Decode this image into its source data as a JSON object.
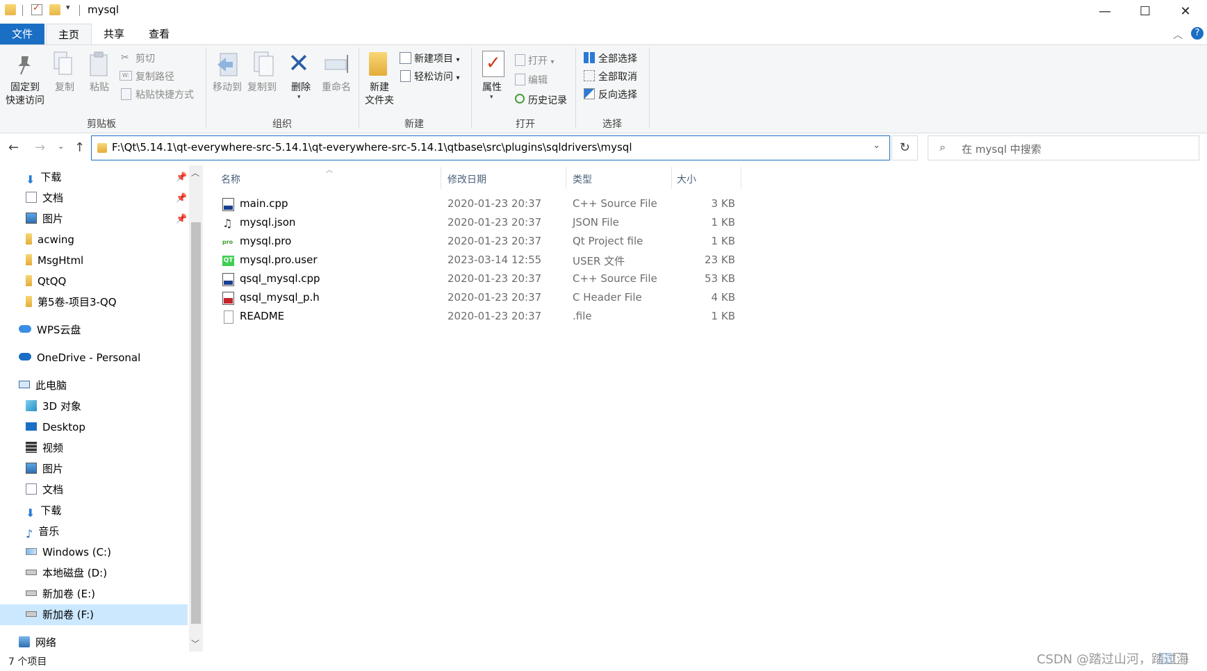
{
  "window": {
    "title": "mysql",
    "minimize_glyph": "—",
    "maximize_glyph": "☐",
    "close_glyph": "✕"
  },
  "tabs": [
    {
      "label": "文件"
    },
    {
      "label": "主页"
    },
    {
      "label": "共享"
    },
    {
      "label": "查看"
    }
  ],
  "ribbon": {
    "clipboard": {
      "group_label": "剪贴板",
      "pin_label_1": "固定到",
      "pin_label_2": "快速访问",
      "copy": "复制",
      "paste": "粘贴",
      "cut": "剪切",
      "copy_path": "复制路径",
      "paste_shortcut": "粘贴快捷方式"
    },
    "organize": {
      "group_label": "组织",
      "move_to": "移动到",
      "copy_to": "复制到",
      "delete": "删除",
      "rename": "重命名"
    },
    "new": {
      "group_label": "新建",
      "new_folder_1": "新建",
      "new_folder_2": "文件夹",
      "new_item": "新建项目",
      "easy_access": "轻松访问"
    },
    "open": {
      "group_label": "打开",
      "properties": "属性",
      "open": "打开",
      "edit": "编辑",
      "history": "历史记录"
    },
    "select": {
      "group_label": "选择",
      "select_all": "全部选择",
      "select_none": "全部取消",
      "invert": "反向选择"
    }
  },
  "address": {
    "path": "F:\\Qt\\5.14.1\\qt-everywhere-src-5.14.1\\qt-everywhere-src-5.14.1\\qtbase\\src\\plugins\\sqldrivers\\mysql",
    "search_placeholder": "在 mysql 中搜索"
  },
  "nav": {
    "quick": [
      {
        "label": "下载",
        "pinned": true
      },
      {
        "label": "文档",
        "pinned": true
      },
      {
        "label": "图片",
        "pinned": true
      },
      {
        "label": "acwing"
      },
      {
        "label": "MsgHtml"
      },
      {
        "label": "QtQQ"
      },
      {
        "label": "第5卷-项目3-QQ"
      }
    ],
    "wps": "WPS云盘",
    "onedrive": "OneDrive - Personal",
    "thispc": "此电脑",
    "pc_items": [
      {
        "label": "3D 对象"
      },
      {
        "label": "Desktop"
      },
      {
        "label": "视频"
      },
      {
        "label": "图片"
      },
      {
        "label": "文档"
      },
      {
        "label": "下载"
      },
      {
        "label": "音乐"
      },
      {
        "label": "Windows (C:)"
      },
      {
        "label": "本地磁盘 (D:)"
      },
      {
        "label": "新加卷 (E:)"
      },
      {
        "label": "新加卷 (F:)"
      }
    ],
    "network": "网络"
  },
  "columns": {
    "name": "名称",
    "date": "修改日期",
    "type": "类型",
    "size": "大小"
  },
  "files": [
    {
      "name": "main.cpp",
      "date": "2020-01-23 20:37",
      "type": "C++ Source File",
      "size": "3 KB",
      "icon": "cpp-file-icon"
    },
    {
      "name": "mysql.json",
      "date": "2020-01-23 20:37",
      "type": "JSON File",
      "size": "1 KB",
      "icon": "json-file-icon"
    },
    {
      "name": "mysql.pro",
      "date": "2020-01-23 20:37",
      "type": "Qt Project file",
      "size": "1 KB",
      "icon": "pro-file-icon"
    },
    {
      "name": "mysql.pro.user",
      "date": "2023-03-14 12:55",
      "type": "USER 文件",
      "size": "23 KB",
      "icon": "qt-user-file-icon"
    },
    {
      "name": "qsql_mysql.cpp",
      "date": "2020-01-23 20:37",
      "type": "C++ Source File",
      "size": "53 KB",
      "icon": "cpp-file-icon"
    },
    {
      "name": "qsql_mysql_p.h",
      "date": "2020-01-23 20:37",
      "type": "C Header File",
      "size": "4 KB",
      "icon": "h-file-icon"
    },
    {
      "name": "README",
      "date": "2020-01-23 20:37",
      "type": ".file",
      "size": "1 KB",
      "icon": "blank-file-icon"
    }
  ],
  "status": {
    "count": "7 个项目"
  },
  "watermark": "CSDN @踏过山河，踏过海"
}
